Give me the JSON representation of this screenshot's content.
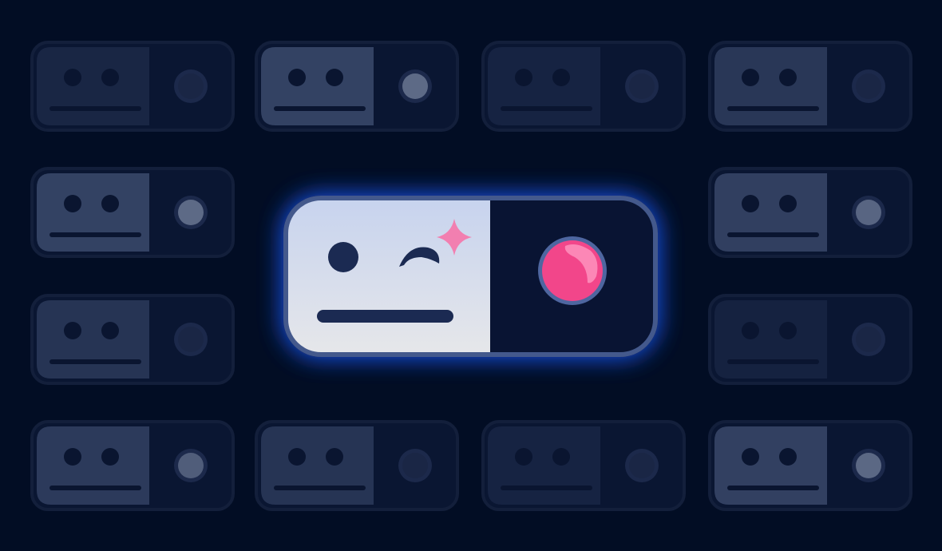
{
  "colors": {
    "background": "#020d24",
    "tile_frame": "#0a1632",
    "tile_frame_border": "#131f3b",
    "knob_dark": "#1b2847",
    "face_feature": "#0a1530",
    "hero_border": "#44598c",
    "hero_glow": "#1f5cff",
    "hero_face_top": "#c7d3ee",
    "hero_face_bottom": "#e6e7ea",
    "hero_feature": "#1b2a52",
    "hero_knob_ring": "#4e66a0",
    "hero_knob": "#f2468a",
    "hero_knob_highlight": "#ff9ec4",
    "sparkle": "#f27fb0"
  },
  "icons": {
    "hero_expression": "winking-face-icon",
    "sparkle": "sparkle-icon",
    "tile_expression": "neutral-face-icon",
    "knob": "toggle-knob-icon"
  },
  "tiles": [
    {
      "id": "r1c1",
      "brightness": 0.18,
      "knob_light": false
    },
    {
      "id": "r1c2",
      "brightness": 0.62,
      "knob_light": true
    },
    {
      "id": "r1c3",
      "brightness": 0.14,
      "knob_light": false
    },
    {
      "id": "r1c4",
      "brightness": 0.45,
      "knob_light": false
    },
    {
      "id": "r2c1",
      "brightness": 0.62,
      "knob_light": true
    },
    {
      "id": "r2c4",
      "brightness": 0.58,
      "knob_light": true
    },
    {
      "id": "r3c1",
      "brightness": 0.4,
      "knob_light": false
    },
    {
      "id": "r3c4",
      "brightness": 0.12,
      "knob_light": false
    },
    {
      "id": "r4c1",
      "brightness": 0.5,
      "knob_light": true
    },
    {
      "id": "r4c2",
      "brightness": 0.4,
      "knob_light": false
    },
    {
      "id": "r4c3",
      "brightness": 0.14,
      "knob_light": false
    },
    {
      "id": "r4c4",
      "brightness": 0.6,
      "knob_light": true
    }
  ]
}
